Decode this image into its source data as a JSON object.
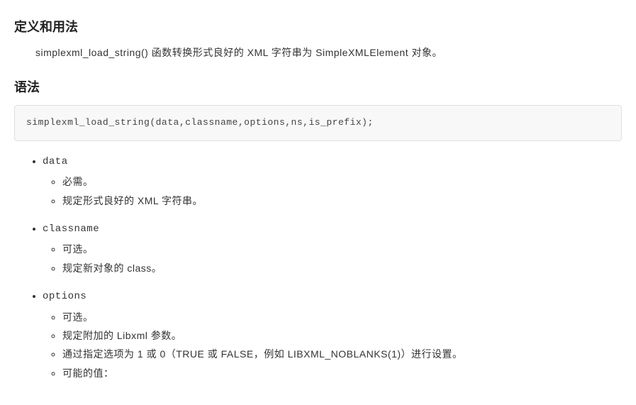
{
  "heading1": "定义和用法",
  "description": "simplexml_load_string() 函数转换形式良好的 XML 字符串为 SimpleXMLElement 对象。",
  "heading2": "语法",
  "syntax_code": "simplexml_load_string(data,classname,options,ns,is_prefix);",
  "params": [
    {
      "name": "data",
      "items": [
        "必需。",
        "规定形式良好的 XML 字符串。"
      ]
    },
    {
      "name": "classname",
      "items": [
        "可选。",
        "规定新对象的 class。"
      ]
    },
    {
      "name": "options",
      "items": [
        "可选。",
        "规定附加的 Libxml 参数。",
        "通过指定选项为 1 或 0（TRUE 或 FALSE，例如 LIBXML_NOBLANKS(1)）进行设置。",
        "可能的值："
      ]
    }
  ]
}
